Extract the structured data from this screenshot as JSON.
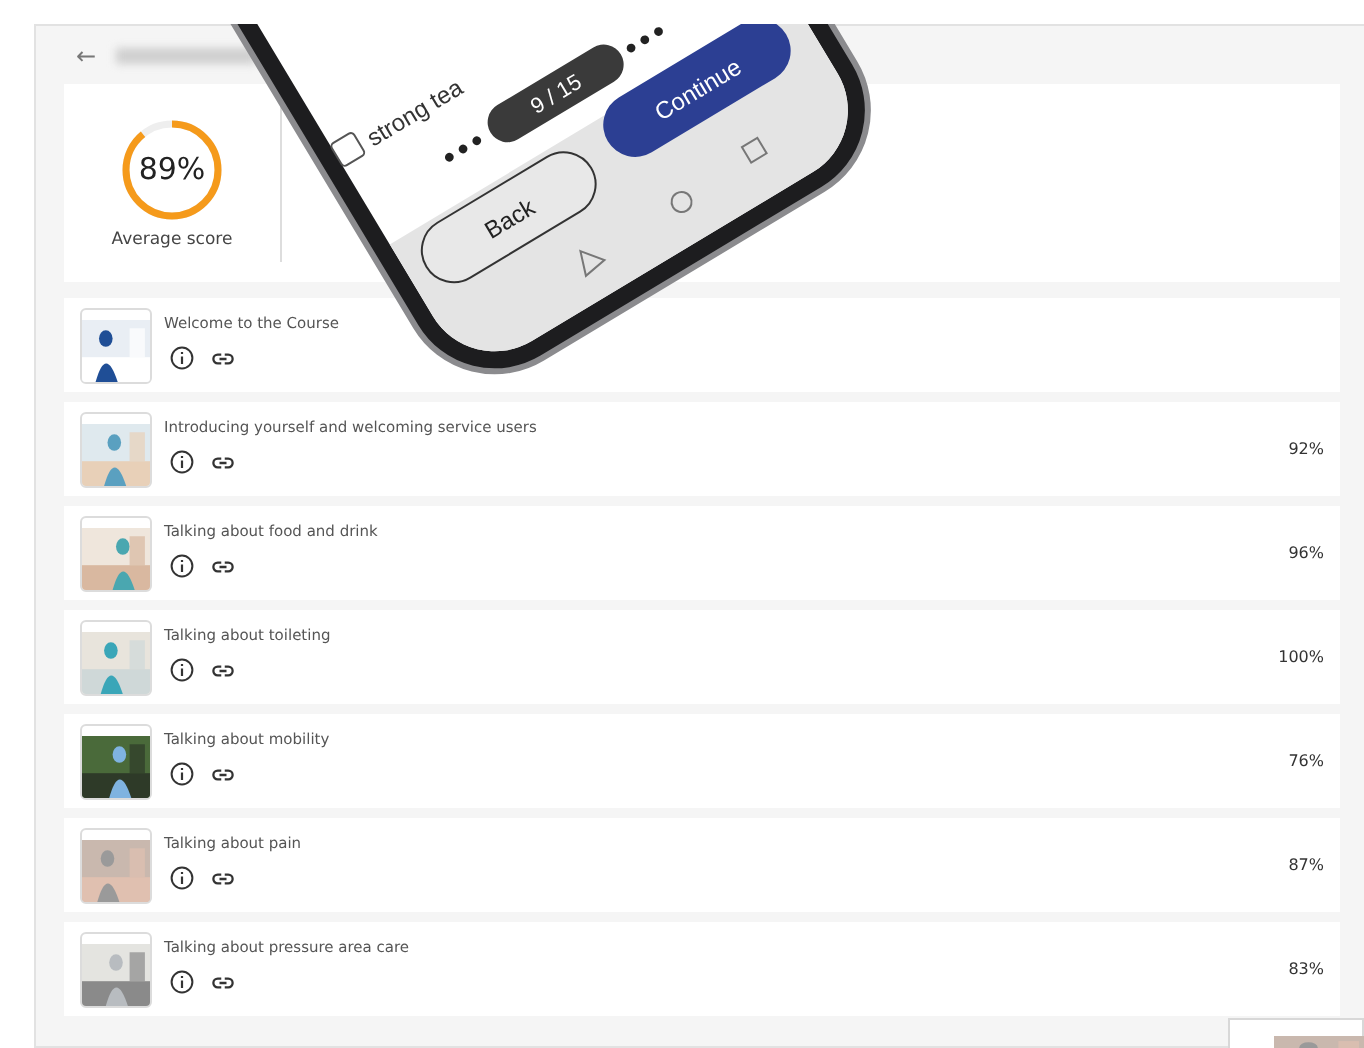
{
  "header": {
    "back": "←"
  },
  "summary": {
    "score": "89%",
    "level": 0.89,
    "label": "Average score"
  },
  "lessons": [
    {
      "title": "Welcome to the Course"
    },
    {
      "title": "Introducing yourself and welcoming service users",
      "score": "92%"
    },
    {
      "title": "Talking about food and drink",
      "score": "96%"
    },
    {
      "title": "Talking about toileting",
      "score": "100%"
    },
    {
      "title": "Talking about mobility",
      "score": "76%"
    },
    {
      "title": "Talking about pain",
      "score": "87%"
    },
    {
      "title": "Talking about pressure area care",
      "score": "83%"
    }
  ],
  "phone": {
    "option": "strong tea",
    "checked": false,
    "progress": "9 / 15",
    "back": "Back",
    "next": "Continue"
  }
}
